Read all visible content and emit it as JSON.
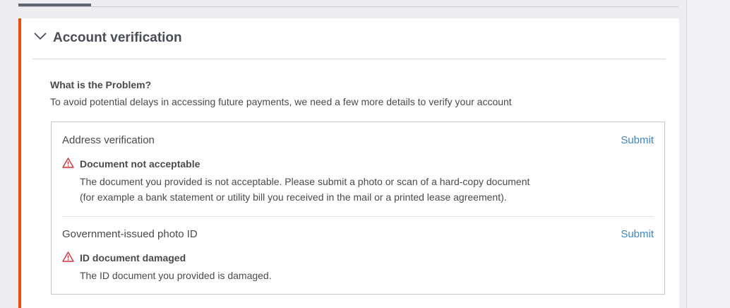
{
  "section": {
    "title": "Account verification",
    "problem_heading": "What is the Problem?",
    "problem_description": "To avoid potential delays in accessing future payments, we need a few more details to verify your account",
    "accent_color": "#ee4b12"
  },
  "issues": [
    {
      "label": "Address verification",
      "action": "Submit",
      "error_icon": "warning-triangle-icon",
      "error_title": "Document not acceptable",
      "error_lines": [
        "The document you provided is not acceptable. Please submit a photo or scan of a hard-copy document",
        "(for example a bank statement or utility bill you received in the mail or a printed lease agreement)."
      ]
    },
    {
      "label": "Government-issued photo ID",
      "action": "Submit",
      "error_icon": "warning-triangle-icon",
      "error_title": "ID document damaged",
      "error_lines": [
        "The ID document you provided is damaged."
      ]
    }
  ],
  "colors": {
    "link": "#3a87c9",
    "warning": "#d0343a",
    "text": "#4a4a4a"
  }
}
